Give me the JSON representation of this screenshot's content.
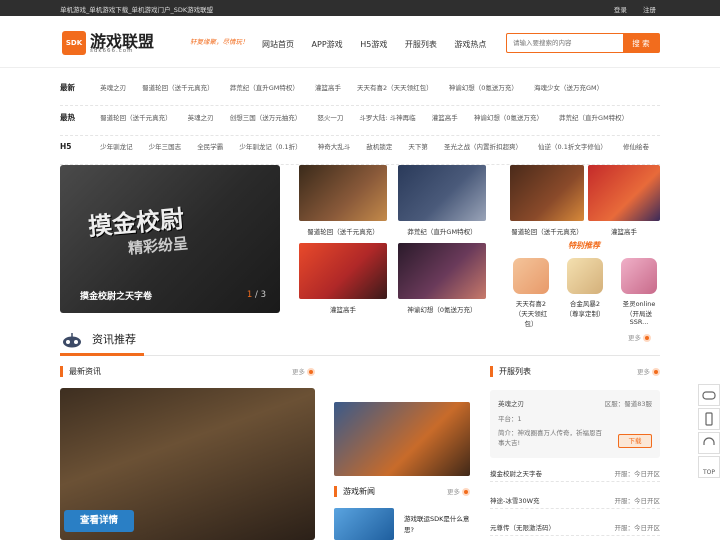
{
  "topbar": {
    "tagline": "单机游戏_单机游戏下载_单机游戏门户_SDK游戏联盟",
    "login": "登录",
    "register": "注册"
  },
  "header": {
    "logo_badge": "SDK",
    "logo_text": "游戏联盟",
    "logo_sub": "sdk666.com",
    "slogan": "轩复缘聚，尽情玩！",
    "nav": [
      "网站首页",
      "APP游戏",
      "H5游戏",
      "开服列表",
      "游戏热点"
    ],
    "search": {
      "placeholder": "请输入要搜索的内容",
      "button": "搜 索"
    }
  },
  "tag_rows": [
    {
      "label": "最新",
      "items": [
        "英魂之刃",
        "蜀道轮回（送千元真充）",
        "莽荒纪（直升GM特权）",
        "灌篮高手",
        "天天有喜2（天天领红包）",
        "神谕幻想（0氪送万充）",
        "海魂少女（送万充GM）"
      ]
    },
    {
      "label": "最热",
      "items": [
        "蜀道轮回（送千元真充）",
        "英魂之刃",
        "创想三国（送万元抽充）",
        "怒火一刀",
        "斗罗大陆: 斗神再临",
        "灌篮高手",
        "神谕幻想（0氪送万充）",
        "莽荒纪（直升GM特权）"
      ]
    },
    {
      "label": "H5",
      "items": [
        "少年驯龙记",
        "少年三国志",
        "全民学霸",
        "少年驯龙记（0.1折）",
        "神奇大乱斗",
        "敌机锁定",
        "天下第",
        "圣光之战（内置折扣超爽）",
        "仙逆（0.1折文字修仙）",
        "修仙绘卷"
      ]
    }
  ],
  "banner": {
    "title_art_1": "摸金校尉",
    "title_art_2": "精彩纷呈",
    "caption": "摸金校尉之天字卷",
    "page_current": "1",
    "page_total": "/ 3"
  },
  "featured_games": [
    {
      "name": "蜀道轮回（送千元真充）",
      "color": "#8a5a3a"
    },
    {
      "name": "莽荒纪（直升GM特权）",
      "color": "#4a5a7a"
    },
    {
      "name": "蜀道轮回（送千元真充）",
      "color": "#8a4a2a"
    },
    {
      "name": "灌篮高手",
      "color": "#c42a2a"
    },
    {
      "name": "神谕幻想（0氪送万充）",
      "color": "#6a3a5a"
    },
    {
      "name": "灌篮高手",
      "color": "#b02828"
    }
  ],
  "hot_recommend": {
    "title": "特别推荐",
    "items": [
      {
        "name": "天天有喜2（天天领红包）",
        "color": "#e89a6a"
      },
      {
        "name": "合金风暴2（尊享定制）",
        "color": "#d4b07a"
      },
      {
        "name": "圣灵online（开局送SSR...",
        "color": "#c86a8a"
      }
    ],
    "more": "更多"
  },
  "news_section": {
    "title": "资讯推荐",
    "latest": {
      "title": "最新资讯",
      "more": "更多",
      "button": "查看详情"
    },
    "game_news": {
      "title": "游戏新闻",
      "more": "更多",
      "item": "游戏联运SDK是什么意思?"
    },
    "server_list": {
      "title": "开服列表",
      "more": "更多",
      "top": {
        "game": "英魂之刃",
        "zone": "区服：蜀道83服",
        "platform": "平台：1",
        "intro": "简介：神戏圈喜万人传奇，祈福恩百事大吉!",
        "download": "下载"
      },
      "rows": [
        {
          "game": "摸金校尉之天字卷",
          "time": "开服：今日开区"
        },
        {
          "game": "神途-冰雪30W充",
          "time": "开服：今日开区"
        },
        {
          "game": "元尊传（无限激活码）",
          "time": "开服：今日开区"
        }
      ]
    }
  },
  "side_float": {
    "top": "TOP"
  }
}
